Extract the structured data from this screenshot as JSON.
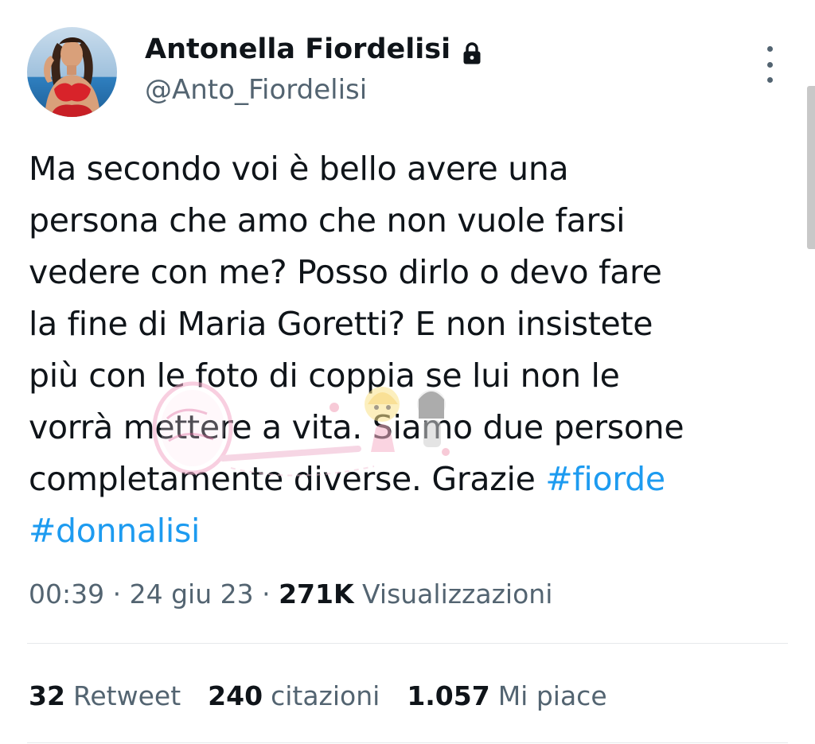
{
  "author": {
    "display_name": "Antonella Fiordelisi",
    "handle": "@Anto_Fiordelisi",
    "protected_icon": "lock-icon",
    "avatar_icon": "profile-photo"
  },
  "tweet": {
    "lines": [
      "Ma secondo voi è bello avere una",
      "persona che amo che non vuole farsi",
      "vedere con me? Posso dirlo o devo fare",
      "la fine di Maria Goretti? E non insistete",
      "più con le foto di coppia se lui non le",
      "vorrà mettere a vita. Siamo due persone"
    ],
    "last_line_text": "completamente diverse. Grazie ",
    "hashtags": [
      "#fiorde",
      "#donnalisi"
    ]
  },
  "meta": {
    "time": "00:39",
    "separator": " · ",
    "date": "24 giu 23",
    "views_count": "271K",
    "views_label": "Visualizzazioni"
  },
  "stats": {
    "retweets_count": "32",
    "retweets_label": "Retweet",
    "quotes_count": "240",
    "quotes_label": "citazioni",
    "likes_count": "1.057",
    "likes_label": "Mi piace"
  },
  "icons": {
    "more": "more-vertical-icon"
  },
  "colors": {
    "text": "#0f1419",
    "secondary": "#536471",
    "link": "#1d9bf0",
    "divider": "#e6e9eb"
  }
}
